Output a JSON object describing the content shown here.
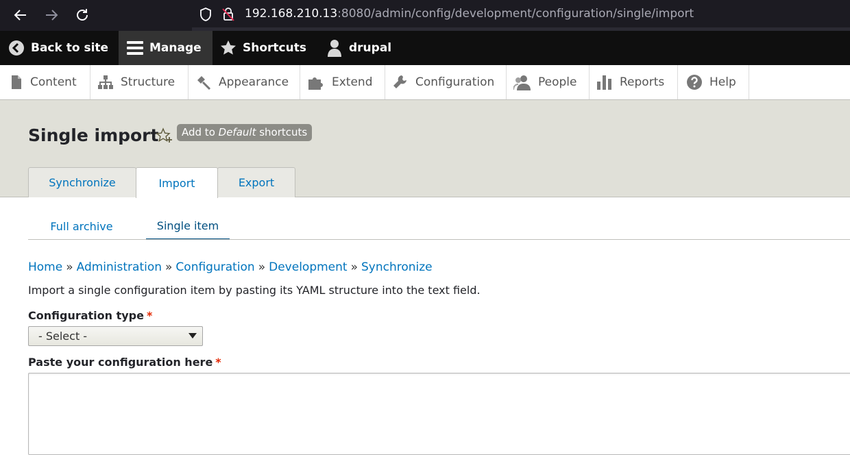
{
  "browser": {
    "url_host": "192.168.210.13",
    "url_rest": ":8080/admin/config/development/configuration/single/import",
    "icons": [
      "back-arrow-icon",
      "forward-arrow-icon",
      "reload-icon",
      "shield-icon",
      "insecure-lock-icon"
    ]
  },
  "toolbar": {
    "back_to_site": "Back to site",
    "manage": "Manage",
    "shortcuts": "Shortcuts",
    "user": "drupal"
  },
  "tray": {
    "items": [
      {
        "label": "Content",
        "icon": "file-icon"
      },
      {
        "label": "Structure",
        "icon": "sitemap-icon"
      },
      {
        "label": "Appearance",
        "icon": "paintbrush-icon"
      },
      {
        "label": "Extend",
        "icon": "puzzle-icon"
      },
      {
        "label": "Configuration",
        "icon": "wrench-icon"
      },
      {
        "label": "People",
        "icon": "person-icon"
      },
      {
        "label": "Reports",
        "icon": "bar-chart-icon"
      },
      {
        "label": "Help",
        "icon": "question-icon"
      }
    ]
  },
  "header": {
    "title": "Single import",
    "shortcut_prefix": "Add to ",
    "shortcut_set": "Default",
    "shortcut_suffix": " shortcuts",
    "tabs": [
      {
        "label": "Synchronize",
        "active": false
      },
      {
        "label": "Import",
        "active": true
      },
      {
        "label": "Export",
        "active": false
      }
    ]
  },
  "subtabs": [
    {
      "label": "Full archive",
      "active": false
    },
    {
      "label": "Single item",
      "active": true
    }
  ],
  "breadcrumb": {
    "items": [
      "Home",
      "Administration",
      "Configuration",
      "Development",
      "Synchronize"
    ],
    "separator": "»"
  },
  "form": {
    "description": "Import a single configuration item by pasting its YAML structure into the text field.",
    "config_type_label": "Configuration type",
    "config_type_value": "- Select -",
    "paste_label": "Paste your configuration here",
    "required_marker": "*",
    "paste_value": ""
  },
  "colors": {
    "link": "#0074bd",
    "toolbar_bg": "#0f0f0f",
    "header_bg": "#e0e0d8",
    "required": "#e32700"
  }
}
